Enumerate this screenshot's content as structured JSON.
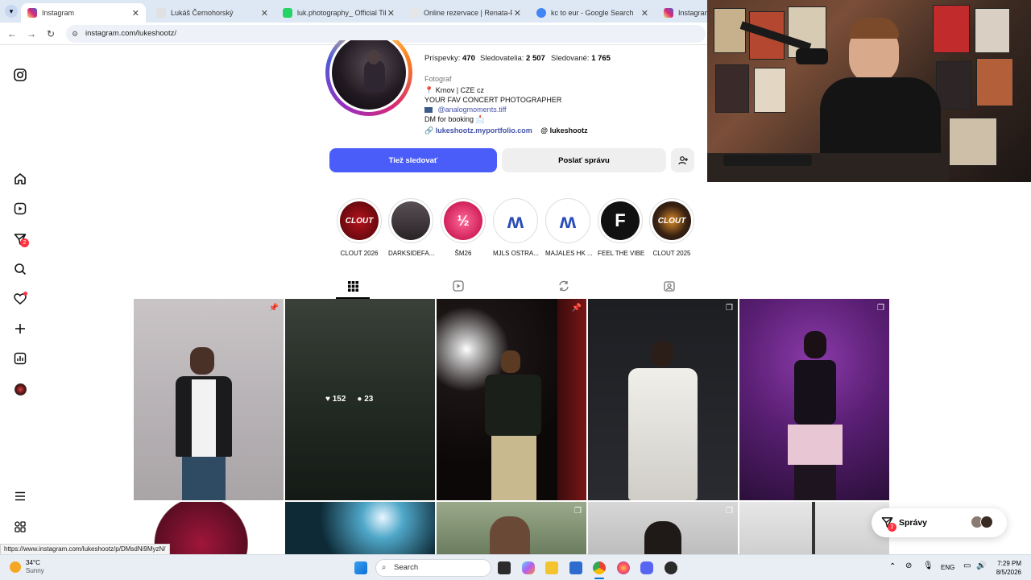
{
  "browser": {
    "tabs": [
      {
        "title": "Instagram",
        "fav": "#d6249f",
        "active": true
      },
      {
        "title": "Lukáš Černohorský",
        "fav": "#e0e0e0"
      },
      {
        "title": "luk.photography_ Official TikTok",
        "fav": "#25d366"
      },
      {
        "title": "Online rezervace | Renata-Foto",
        "fav": "#e6e6e6"
      },
      {
        "title": "kc to eur - Google Search",
        "fav": "#4285f4"
      },
      {
        "title": "Instagram",
        "fav": "#d6249f"
      }
    ],
    "url": "instagram.com/lukeshootz/"
  },
  "sidebar": {
    "notif_count": "2"
  },
  "profile": {
    "stats": [
      {
        "label": "Príspevky:",
        "value": "470"
      },
      {
        "label": "Sledovatelia:",
        "value": "2 507"
      },
      {
        "label": "Sledované:",
        "value": "1 765"
      }
    ],
    "category": "Fotograf",
    "location": "📍 Krnov | CZE cz",
    "tagline": "YOUR FAV CONCERT PHOTOGRAPHER",
    "secondary": "@analogmoments.tiff",
    "booking": "DM for booking 📩",
    "link": "lukeshootz.myportfolio.com",
    "threads": "lukeshootz",
    "follow_label": "Tiež sledovať",
    "message_label": "Poslať správu"
  },
  "highlights": [
    {
      "label": "CLOUT 2026",
      "text": "CLOUT",
      "bg": "#b5121b"
    },
    {
      "label": "DARKSIDEFA...",
      "text": "",
      "bg": "#3a3236"
    },
    {
      "label": "ŠM26",
      "text": "½",
      "bg": "#e8356e"
    },
    {
      "label": "MJLS OSTRA...",
      "text": "ʍ",
      "bg": "#ffffff"
    },
    {
      "label": "MAJALES HK ...",
      "text": "ʍ",
      "bg": "#ffffff"
    },
    {
      "label": "FEEL THE VIBE",
      "text": "F",
      "bg": "#111111"
    },
    {
      "label": "CLOUT 2025",
      "text": "CLOUT",
      "bg": "#1d1a18"
    }
  ],
  "post_overlay": {
    "likes": "152",
    "comments": "23"
  },
  "messages": {
    "label": "Správy",
    "count": "2"
  },
  "status_url": "https://www.instagram.com/lukeshootz/p/DMsdNi9MyzN/",
  "taskbar": {
    "temp": "34°C",
    "weather": "Sunny",
    "search": "Search",
    "lang": "ENG",
    "time": "7:29 PM",
    "date": "8/5/2026"
  }
}
